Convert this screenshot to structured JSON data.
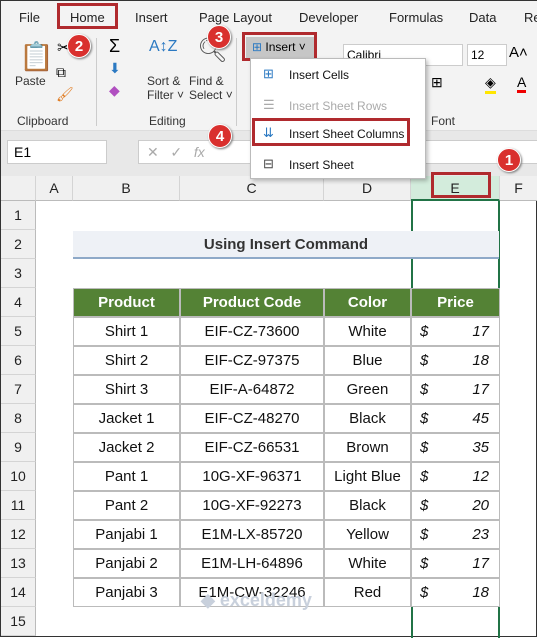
{
  "tabs": [
    "File",
    "Home",
    "Insert",
    "Page Layout",
    "Developer",
    "Formulas",
    "Data",
    "Re"
  ],
  "ribbon": {
    "paste": "Paste",
    "sort": "Sort &",
    "filter": "Filter",
    "find": "Find &",
    "select": "Select",
    "clipboard": "Clipboard",
    "editing": "Editing",
    "font_group": "Font",
    "insert_btn": "Insert",
    "font_name": "Calibri",
    "font_size": "12"
  },
  "menu": [
    "Insert Cells",
    "Insert Sheet Rows",
    "Insert Sheet Columns",
    "Insert Sheet"
  ],
  "name_box": "E1",
  "columns": [
    "A",
    "B",
    "C",
    "D",
    "E",
    "F"
  ],
  "rows": [
    "1",
    "2",
    "3",
    "4",
    "5",
    "6",
    "7",
    "8",
    "9",
    "10",
    "11",
    "12",
    "13",
    "14",
    "15"
  ],
  "title": "Using Insert Command",
  "table": {
    "headers": [
      "Product",
      "Product Code",
      "Color",
      "Price"
    ],
    "rows": [
      [
        "Shirt 1",
        "EIF-CZ-73600",
        "White",
        "$",
        "17"
      ],
      [
        "Shirt 2",
        "EIF-CZ-97375",
        "Blue",
        "$",
        "18"
      ],
      [
        "Shirt 3",
        "EIF-A-64872",
        "Green",
        "$",
        "17"
      ],
      [
        "Jacket 1",
        "EIF-CZ-48270",
        "Black",
        "$",
        "45"
      ],
      [
        "Jacket 2",
        "EIF-CZ-66531",
        "Brown",
        "$",
        "35"
      ],
      [
        "Pant 1",
        "10G-XF-96371",
        "Light Blue",
        "$",
        "12"
      ],
      [
        "Pant 2",
        "10G-XF-92273",
        "Black",
        "$",
        "20"
      ],
      [
        "Panjabi 1",
        "E1M-LX-85720",
        "Yellow",
        "$",
        "23"
      ],
      [
        "Panjabi 2",
        "E1M-LH-64896",
        "White",
        "$",
        "17"
      ],
      [
        "Panjabi 3",
        "E1M-CW-32246",
        "Red",
        "$",
        "18"
      ]
    ]
  },
  "badges": [
    "1",
    "2",
    "3",
    "4"
  ],
  "watermark": "exceldemy",
  "colors": {
    "header_green": "#548235",
    "badge_red": "#d9302e"
  }
}
